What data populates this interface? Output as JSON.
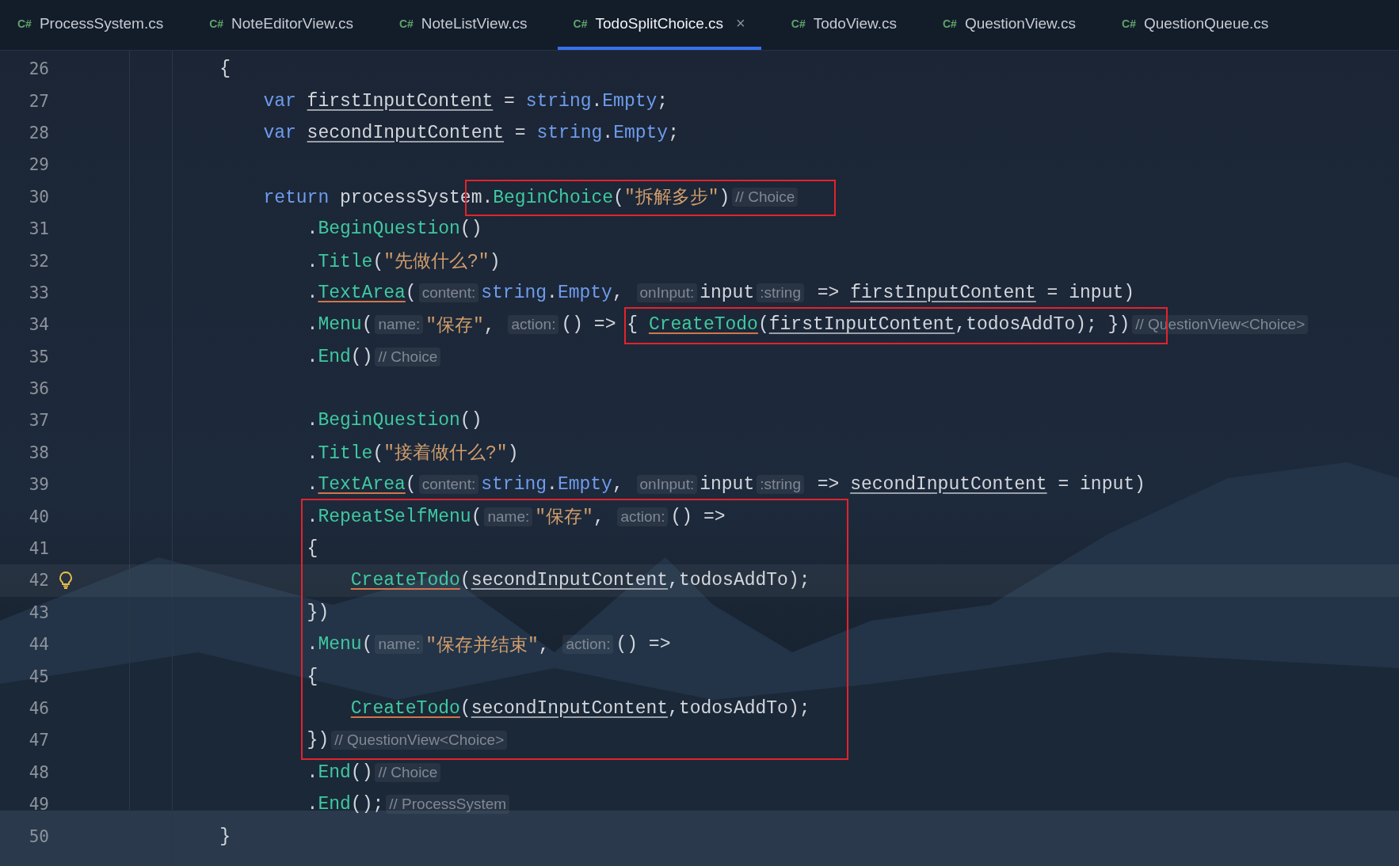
{
  "tabs": [
    {
      "icon": "C#",
      "label": "ProcessSystem.cs",
      "selected": false
    },
    {
      "icon": "C#",
      "label": "NoteEditorView.cs",
      "selected": false
    },
    {
      "icon": "C#",
      "label": "NoteListView.cs",
      "selected": false
    },
    {
      "icon": "C#",
      "label": "TodoSplitChoice.cs",
      "selected": true,
      "close": "×"
    },
    {
      "icon": "C#",
      "label": "TodoView.cs",
      "selected": false
    },
    {
      "icon": "C#",
      "label": "QuestionView.cs",
      "selected": false
    },
    {
      "icon": "C#",
      "label": "QuestionQueue.cs",
      "selected": false
    }
  ],
  "lines": [
    {
      "number": "26",
      "kind": "brace",
      "parts": [
        {
          "kind": "plain",
          "text": "{"
        }
      ]
    },
    {
      "number": "27",
      "kind": "statement",
      "parts": [
        {
          "kind": "keyword",
          "text": "var "
        },
        {
          "kind": "local",
          "text": "firstInputContent"
        },
        {
          "kind": "plain",
          "text": " = "
        },
        {
          "kind": "keyword",
          "text": "string"
        },
        {
          "kind": "plain",
          "text": "."
        },
        {
          "kind": "keyword",
          "text": "Empty"
        },
        {
          "kind": "plain",
          "text": ";"
        }
      ]
    },
    {
      "number": "28",
      "kind": "statement",
      "parts": [
        {
          "kind": "keyword",
          "text": "var "
        },
        {
          "kind": "local",
          "text": "secondInputContent"
        },
        {
          "kind": "plain",
          "text": " = "
        },
        {
          "kind": "keyword",
          "text": "string"
        },
        {
          "kind": "plain",
          "text": "."
        },
        {
          "kind": "keyword",
          "text": "Empty"
        },
        {
          "kind": "plain",
          "text": ";"
        }
      ]
    },
    {
      "number": "29",
      "kind": "blank"
    },
    {
      "number": "30",
      "kind": "statement",
      "parts": [
        {
          "kind": "keyword",
          "text": "return"
        },
        {
          "kind": "plain",
          "text": " processSyste"
        },
        {
          "kind": "plain",
          "text": "m.",
          "box_start": true
        },
        {
          "kind": "method",
          "text": "BeginChoice"
        },
        {
          "kind": "plain",
          "text": "("
        },
        {
          "kind": "string",
          "text": "\"拆解多步\""
        },
        {
          "kind": "plain",
          "text": ")"
        },
        {
          "kind": "comment",
          "text": "// Choice",
          "box_end": true
        }
      ]
    },
    {
      "number": "31",
      "kind": "chain",
      "parts": [
        {
          "kind": "plain",
          "text": "."
        },
        {
          "kind": "method",
          "text": "BeginQuestion"
        },
        {
          "kind": "plain",
          "text": "()"
        }
      ]
    },
    {
      "number": "32",
      "kind": "chain",
      "parts": [
        {
          "kind": "plain",
          "text": "."
        },
        {
          "kind": "method",
          "text": "Title"
        },
        {
          "kind": "plain",
          "text": "("
        },
        {
          "kind": "string",
          "text": "\"先做什么?\""
        },
        {
          "kind": "plain",
          "text": ")"
        }
      ]
    },
    {
      "number": "33",
      "kind": "chain",
      "parts": [
        {
          "kind": "plain",
          "text": "."
        },
        {
          "kind": "method_ref",
          "text": "TextArea"
        },
        {
          "kind": "plain",
          "text": "("
        },
        {
          "kind": "hint",
          "text": "content:"
        },
        {
          "kind": "keyword",
          "text": "string"
        },
        {
          "kind": "plain",
          "text": "."
        },
        {
          "kind": "keyword",
          "text": "Empty"
        },
        {
          "kind": "plain",
          "text": ", "
        },
        {
          "kind": "hint",
          "text": "onInput:"
        },
        {
          "kind": "plain",
          "text": "input"
        },
        {
          "kind": "hint",
          "text": ":string"
        },
        {
          "kind": "plain",
          "text": " => "
        },
        {
          "kind": "local",
          "text": "firstInputContent"
        },
        {
          "kind": "plain",
          "text": " = input)"
        }
      ]
    },
    {
      "number": "34",
      "kind": "chain",
      "parts": [
        {
          "kind": "plain",
          "text": "."
        },
        {
          "kind": "method",
          "text": "Menu"
        },
        {
          "kind": "plain",
          "text": "("
        },
        {
          "kind": "hint",
          "text": "name:"
        },
        {
          "kind": "string",
          "text": "\"保存\""
        },
        {
          "kind": "plain",
          "text": ", "
        },
        {
          "kind": "hint",
          "text": "action:"
        },
        {
          "kind": "plain",
          "text": "() => "
        },
        {
          "kind": "plain",
          "text": "{ ",
          "box_start": true
        },
        {
          "kind": "method_ref",
          "text": "CreateTodo"
        },
        {
          "kind": "plain",
          "text": "("
        },
        {
          "kind": "local",
          "text": "firstInputContent"
        },
        {
          "kind": "plain",
          "text": ",todosAddTo); })",
          "box_end": true
        },
        {
          "kind": "comment",
          "text": "// QuestionView<Choice>"
        }
      ]
    },
    {
      "number": "35",
      "kind": "chain",
      "parts": [
        {
          "kind": "plain",
          "text": "."
        },
        {
          "kind": "method",
          "text": "End"
        },
        {
          "kind": "plain",
          "text": "()"
        },
        {
          "kind": "comment",
          "text": "// Choice"
        }
      ]
    },
    {
      "number": "36",
      "kind": "blank"
    },
    {
      "number": "37",
      "kind": "chain",
      "parts": [
        {
          "kind": "plain",
          "text": "."
        },
        {
          "kind": "method",
          "text": "BeginQuestion"
        },
        {
          "kind": "plain",
          "text": "()"
        }
      ]
    },
    {
      "number": "38",
      "kind": "chain",
      "parts": [
        {
          "kind": "plain",
          "text": "."
        },
        {
          "kind": "method",
          "text": "Title"
        },
        {
          "kind": "plain",
          "text": "("
        },
        {
          "kind": "string",
          "text": "\"接着做什么?\""
        },
        {
          "kind": "plain",
          "text": ")"
        }
      ]
    },
    {
      "number": "39",
      "kind": "chain",
      "parts": [
        {
          "kind": "plain",
          "text": "."
        },
        {
          "kind": "method_ref",
          "text": "TextArea"
        },
        {
          "kind": "plain",
          "text": "("
        },
        {
          "kind": "hint",
          "text": "content:"
        },
        {
          "kind": "keyword",
          "text": "string"
        },
        {
          "kind": "plain",
          "text": "."
        },
        {
          "kind": "keyword",
          "text": "Empty"
        },
        {
          "kind": "plain",
          "text": ", "
        },
        {
          "kind": "hint",
          "text": "onInput:"
        },
        {
          "kind": "plain",
          "text": "input"
        },
        {
          "kind": "hint",
          "text": ":string"
        },
        {
          "kind": "plain",
          "text": " => "
        },
        {
          "kind": "local",
          "text": "secondInputContent"
        },
        {
          "kind": "plain",
          "text": " = input)"
        }
      ]
    },
    {
      "number": "40",
      "kind": "chain",
      "parts": [
        {
          "kind": "plain",
          "text": ".",
          "box_start": true
        },
        {
          "kind": "method",
          "text": "RepeatSelfMenu"
        },
        {
          "kind": "plain",
          "text": "("
        },
        {
          "kind": "hint",
          "text": "name:"
        },
        {
          "kind": "string",
          "text": "\"保存\""
        },
        {
          "kind": "plain",
          "text": ", "
        },
        {
          "kind": "hint",
          "text": "action:"
        },
        {
          "kind": "plain",
          "text": "() =>"
        }
      ]
    },
    {
      "number": "41",
      "kind": "chain",
      "parts": [
        {
          "kind": "plain",
          "text": "{"
        }
      ]
    },
    {
      "number": "42",
      "kind": "body",
      "current": true,
      "bulb": true,
      "parts": [
        {
          "kind": "method_ref",
          "text": "CreateTodo"
        },
        {
          "kind": "plain",
          "text": "("
        },
        {
          "kind": "local",
          "text": "secondInputContent"
        },
        {
          "kind": "plain",
          "text": ",todosAddTo);"
        }
      ]
    },
    {
      "number": "43",
      "kind": "chain",
      "parts": [
        {
          "kind": "plain",
          "text": "})"
        }
      ]
    },
    {
      "number": "44",
      "kind": "chain",
      "parts": [
        {
          "kind": "plain",
          "text": "."
        },
        {
          "kind": "method",
          "text": "Menu"
        },
        {
          "kind": "plain",
          "text": "("
        },
        {
          "kind": "hint",
          "text": "name:"
        },
        {
          "kind": "string",
          "text": "\"保存并结束\""
        },
        {
          "kind": "plain",
          "text": ", "
        },
        {
          "kind": "hint",
          "text": "action:"
        },
        {
          "kind": "plain",
          "text": "() =>"
        }
      ]
    },
    {
      "number": "45",
      "kind": "chain",
      "parts": [
        {
          "kind": "plain",
          "text": "{"
        }
      ]
    },
    {
      "number": "46",
      "kind": "body",
      "parts": [
        {
          "kind": "method_ref",
          "text": "CreateTodo"
        },
        {
          "kind": "plain",
          "text": "("
        },
        {
          "kind": "local",
          "text": "secondInputContent"
        },
        {
          "kind": "plain",
          "text": ",todosAddTo);"
        }
      ]
    },
    {
      "number": "47",
      "kind": "chain",
      "parts": [
        {
          "kind": "plain",
          "text": "})"
        },
        {
          "kind": "comment",
          "text": "// QuestionView<Choice>",
          "box_end": true
        }
      ]
    },
    {
      "number": "48",
      "kind": "chain",
      "parts": [
        {
          "kind": "plain",
          "text": "."
        },
        {
          "kind": "method",
          "text": "End"
        },
        {
          "kind": "plain",
          "text": "()"
        },
        {
          "kind": "comment",
          "text": "// Choice"
        }
      ]
    },
    {
      "number": "49",
      "kind": "chain",
      "parts": [
        {
          "kind": "plain",
          "text": "."
        },
        {
          "kind": "method",
          "text": "End"
        },
        {
          "kind": "plain",
          "text": "();"
        },
        {
          "kind": "comment",
          "text": "// ProcessSystem"
        }
      ]
    },
    {
      "number": "50",
      "kind": "brace",
      "parts": [
        {
          "kind": "plain",
          "text": "}"
        }
      ]
    }
  ]
}
